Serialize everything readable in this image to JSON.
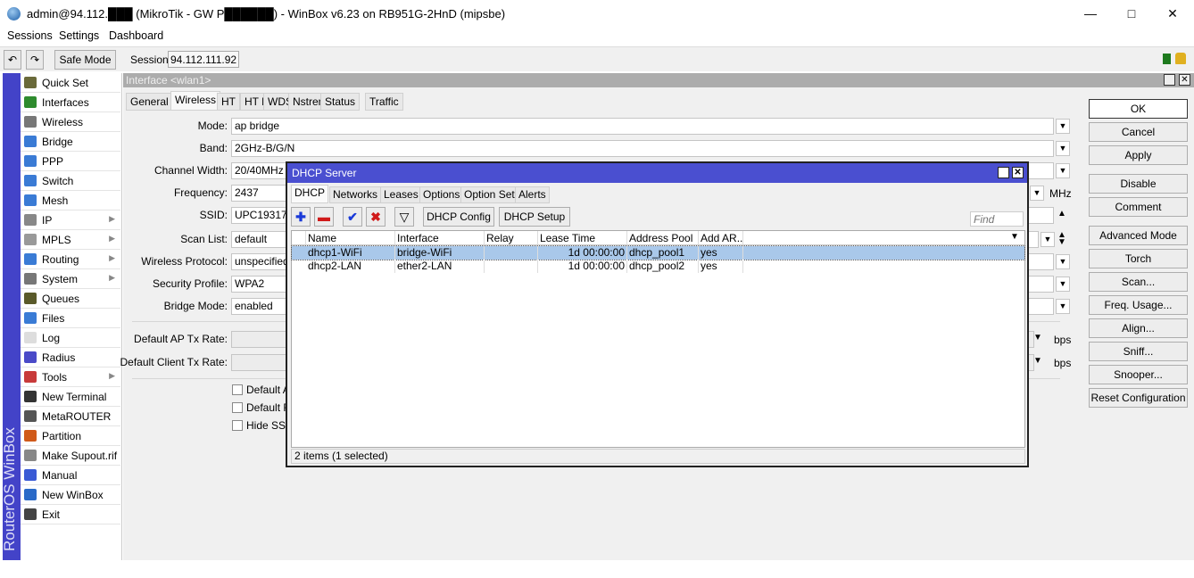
{
  "window": {
    "title": "admin@94.112.███ (MikroTik - GW P██████) - WinBox v6.23 on RB951G-2HnD (mipsbe)",
    "min": "—",
    "max": "□",
    "close": "✕"
  },
  "menu": [
    "Sessions",
    "Settings",
    "Dashboard"
  ],
  "toolbar": {
    "undo": "↶",
    "redo": "↷",
    "safe_mode": "Safe Mode",
    "session_label": "Session:",
    "session_value": "94.112.111.92"
  },
  "brand": "RouterOS WinBox",
  "sidebar": [
    {
      "label": "Quick Set",
      "color": "#6a6a3a"
    },
    {
      "label": "Interfaces",
      "color": "#2e8b2e"
    },
    {
      "label": "Wireless",
      "color": "#777"
    },
    {
      "label": "Bridge",
      "color": "#3a7bd5"
    },
    {
      "label": "PPP",
      "color": "#3a7bd5"
    },
    {
      "label": "Switch",
      "color": "#3a7bd5"
    },
    {
      "label": "Mesh",
      "color": "#3a7bd5"
    },
    {
      "label": "IP",
      "color": "#888",
      "sub": true
    },
    {
      "label": "MPLS",
      "color": "#999",
      "sub": true
    },
    {
      "label": "Routing",
      "color": "#3a7bd5",
      "sub": true
    },
    {
      "label": "System",
      "color": "#777",
      "sub": true
    },
    {
      "label": "Queues",
      "color": "#5a5a2a"
    },
    {
      "label": "Files",
      "color": "#3a7bd5"
    },
    {
      "label": "Log",
      "color": "#ddd"
    },
    {
      "label": "Radius",
      "color": "#4a4ac8"
    },
    {
      "label": "Tools",
      "color": "#c83a3a",
      "sub": true
    },
    {
      "label": "New Terminal",
      "color": "#333"
    },
    {
      "label": "MetaROUTER",
      "color": "#555"
    },
    {
      "label": "Partition",
      "color": "#d05a1a"
    },
    {
      "label": "Make Supout.rif",
      "color": "#888"
    },
    {
      "label": "Manual",
      "color": "#3a5ad5"
    },
    {
      "label": "New WinBox",
      "color": "#2a6ac8"
    },
    {
      "label": "Exit",
      "color": "#444"
    }
  ],
  "interface": {
    "title": "Interface <wlan1>",
    "tabs": [
      "General",
      "Wireless",
      "HT",
      "HT MCS",
      "WDS",
      "Nstreme",
      "Status",
      "Traffic"
    ],
    "active_tab": "Wireless",
    "fields": [
      {
        "label": "Mode:",
        "value": "ap bridge"
      },
      {
        "label": "Band:",
        "value": "2GHz-B/G/N"
      },
      {
        "label": "Channel Width:",
        "value": "20/40MHz H"
      },
      {
        "label": "Frequency:",
        "value": "2437",
        "unit": "MHz"
      },
      {
        "label": "SSID:",
        "value": "UPC193175"
      },
      {
        "label": "Scan List:",
        "value": "default"
      },
      {
        "label": "Wireless Protocol:",
        "value": "unspecified"
      },
      {
        "label": "Security Profile:",
        "value": "WPA2"
      },
      {
        "label": "Bridge Mode:",
        "value": "enabled"
      }
    ],
    "rates": [
      {
        "label": "Default AP Tx Rate:",
        "unit": "bps"
      },
      {
        "label": "Default Client Tx Rate:",
        "unit": "bps"
      }
    ],
    "checkboxes": [
      "Default A",
      "Default F",
      "Hide SSII"
    ],
    "buttons": [
      "OK",
      "Cancel",
      "Apply",
      "Disable",
      "Comment",
      "Advanced Mode",
      "Torch",
      "Scan...",
      "Freq. Usage...",
      "Align...",
      "Sniff...",
      "Snooper...",
      "Reset Configuration"
    ]
  },
  "dhcp": {
    "title": "DHCP Server",
    "tabs": [
      "DHCP",
      "Networks",
      "Leases",
      "Options",
      "Option Sets",
      "Alerts"
    ],
    "active_tab": "DHCP",
    "config_button": "DHCP Config",
    "setup_button": "DHCP Setup",
    "find_placeholder": "Find",
    "columns": [
      "Name",
      "Interface",
      "Relay",
      "Lease Time",
      "Address Pool",
      "Add AR..."
    ],
    "rows": [
      [
        "dhcp1-WiFi",
        "bridge-WiFi",
        "",
        "1d 00:00:00",
        "dhcp_pool1",
        "yes"
      ],
      [
        "dhcp2-LAN",
        "ether2-LAN",
        "",
        "1d 00:00:00",
        "dhcp_pool2",
        "yes"
      ]
    ],
    "selected_row": 0,
    "status": "2 items (1 selected)"
  }
}
